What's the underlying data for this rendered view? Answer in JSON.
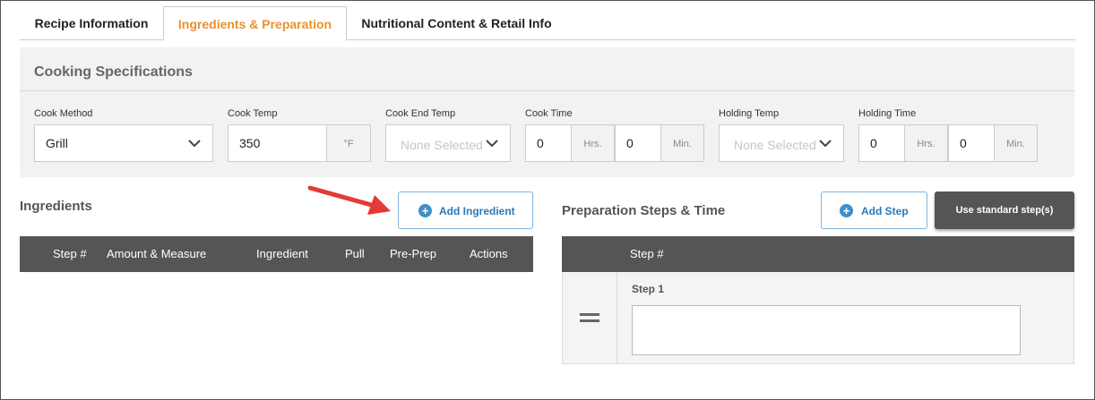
{
  "tabs": [
    {
      "label": "Recipe Information"
    },
    {
      "label": "Ingredients & Preparation"
    },
    {
      "label": "Nutritional Content & Retail Info"
    }
  ],
  "active_tab": "Ingredients & Preparation",
  "colors": {
    "active_tab": "#e8922d",
    "dark_header": "#555555",
    "accent_blue": "#3f8fc9",
    "annotation_arrow": "#e53a36"
  },
  "cooking_specs": {
    "title": "Cooking Specifications",
    "cook_method": {
      "label": "Cook Method",
      "value": "Grill"
    },
    "cook_temp": {
      "label": "Cook Temp",
      "value": "350",
      "unit": "°F"
    },
    "cook_end_temp": {
      "label": "Cook End Temp",
      "placeholder": "None Selected"
    },
    "cook_time": {
      "label": "Cook Time",
      "hrs": "0",
      "hrs_unit": "Hrs.",
      "min": "0",
      "min_unit": "Min."
    },
    "holding_temp": {
      "label": "Holding Temp",
      "placeholder": "None Selected"
    },
    "holding_time": {
      "label": "Holding Time",
      "hrs": "0",
      "hrs_unit": "Hrs.",
      "min": "0",
      "min_unit": "Min."
    }
  },
  "ingredients": {
    "title": "Ingredients",
    "add_button": "Add Ingredient",
    "columns": [
      "Step #",
      "Amount & Measure",
      "Ingredient",
      "Pull",
      "Pre-Prep",
      "Actions"
    ]
  },
  "preparation": {
    "title": "Preparation Steps & Time",
    "add_button": "Add Step",
    "standard_button": "Use standard step(s)",
    "columns": [
      "Step #"
    ],
    "steps": [
      {
        "label": "Step 1",
        "value": ""
      }
    ]
  },
  "icons": {
    "dropdown": "chevron-down-icon",
    "add": "plus-circle-icon",
    "drag": "drag-handle-icon",
    "annotation": "red-arrow-icon"
  }
}
